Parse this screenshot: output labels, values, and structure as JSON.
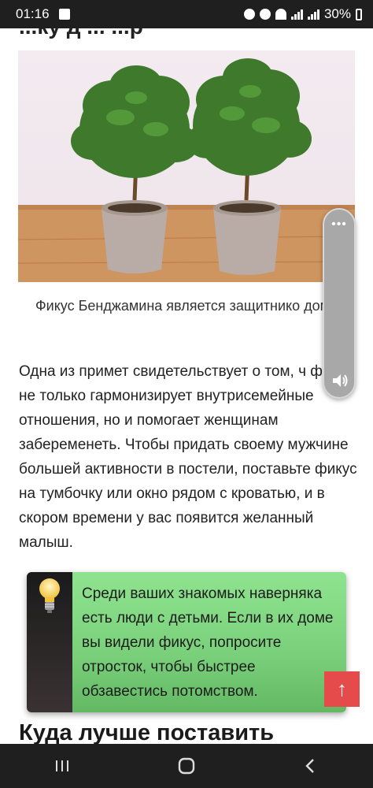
{
  "status_bar": {
    "time": "01:16",
    "battery": "30%"
  },
  "article": {
    "clipped_heading": "...ку д ... ...р",
    "image_caption": "Фикус Бенджамина является защитнико дома",
    "paragraph": "Одна из примет свидетельствует о том, ч фикус не только гармонизирует внутрисемейные отношения, но и помогает женщинам забеременеть. Чтобы придать своему мужчине большей активности в постели, поставьте фикус на тумбочку или окно рядом с кроватью, и в скором времени у вас появится желанный малыш.",
    "tip_text": "Среди ваших знакомых наверняка есть люди с детьми. Если в их доме вы видели фикус, попросите отросток, чтобы быстрее обзавестись потомством.",
    "section_heading": "Куда лучше поставить"
  },
  "controls": {
    "back_to_top_label": "↑",
    "volume_menu_label": "•••"
  },
  "icons": {
    "tip_icon": "lightbulb-icon",
    "volume_icon": "speaker-icon"
  },
  "colors": {
    "tip_green": "#7ad07a",
    "back_to_top_red": "#e64b4b"
  }
}
